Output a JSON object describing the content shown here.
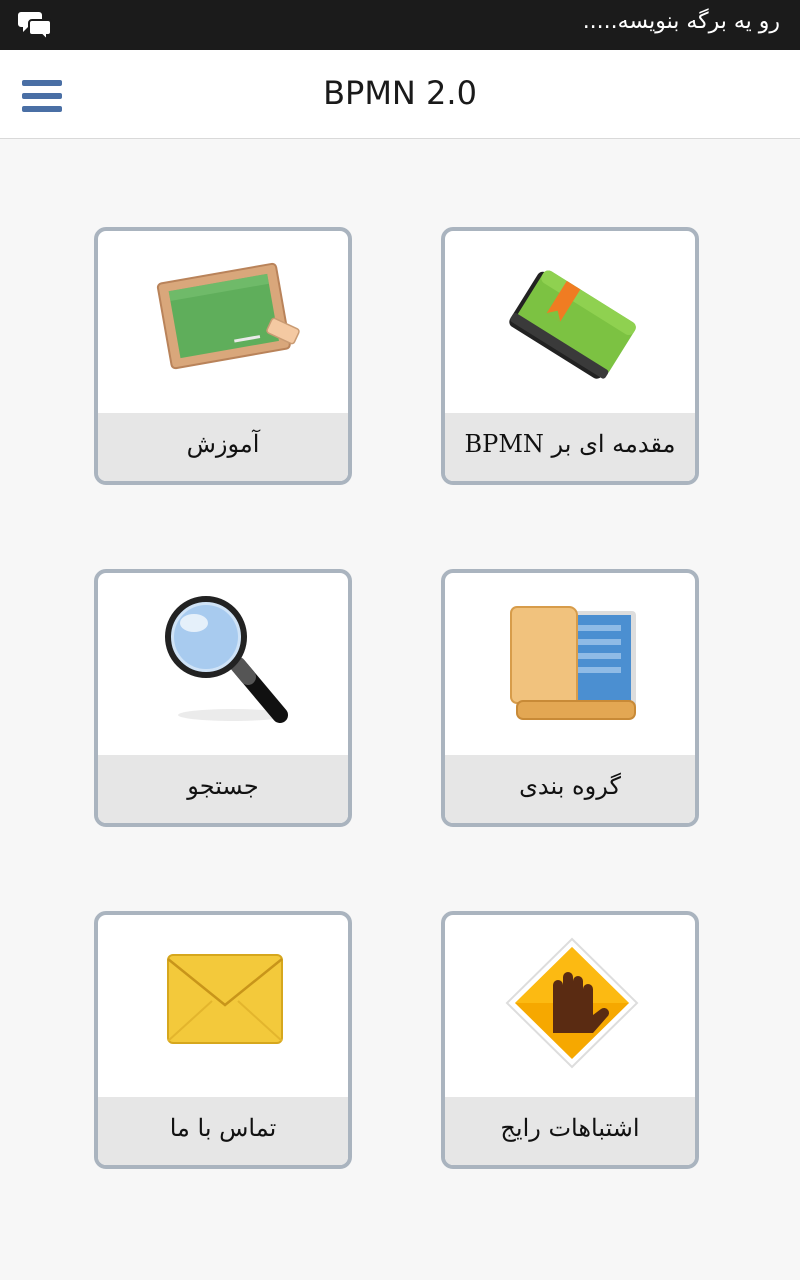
{
  "status_bar": {
    "notification_text": "رو یه برگه بنویسه.....",
    "left_icon": "chat-bubbles-icon"
  },
  "app_bar": {
    "title": "BPMN 2.0",
    "menu_icon": "hamburger-menu-icon",
    "accent_color": "#4a6fa5"
  },
  "grid": {
    "items": [
      {
        "label": "آموزش",
        "icon": "chalkboard-icon"
      },
      {
        "label": "مقدمه ای بر BPMN",
        "icon": "green-book-icon"
      },
      {
        "label": "جستجو",
        "icon": "magnifier-icon"
      },
      {
        "label": "گروه بندی",
        "icon": "folder-icon"
      },
      {
        "label": "تماس با ما",
        "icon": "envelope-icon"
      },
      {
        "label": "اشتباهات رایج",
        "icon": "stop-hand-sign-icon"
      }
    ]
  }
}
